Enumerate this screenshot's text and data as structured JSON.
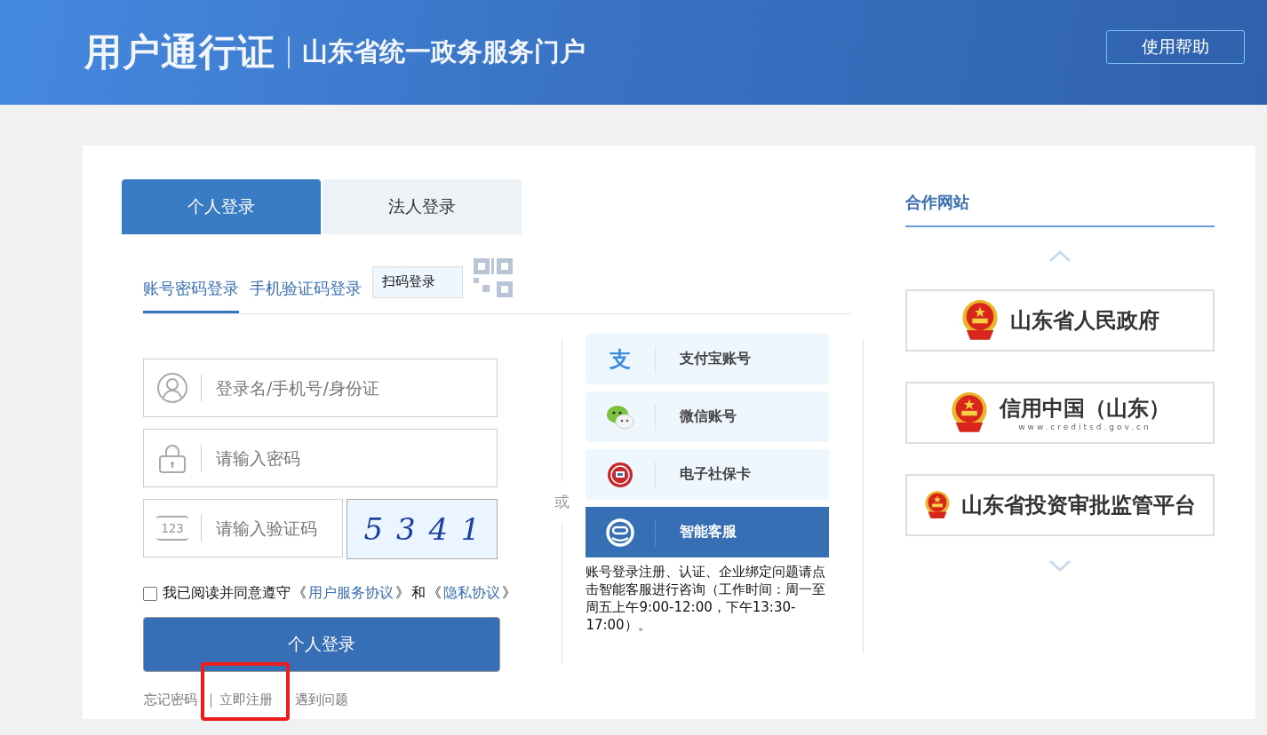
{
  "header": {
    "title": "用户通行证",
    "subtitle": "山东省统一政务服务门户",
    "help_button": "使用帮助"
  },
  "login_tabs": [
    {
      "label": "个人登录",
      "selected": true
    },
    {
      "label": "法人登录",
      "selected": false
    }
  ],
  "method_tabs": [
    {
      "label": "账号密码登录",
      "kind": "text",
      "selected": true
    },
    {
      "label": "手机验证码登录",
      "kind": "text",
      "selected": false
    },
    {
      "label": "扫码登录",
      "kind": "qr",
      "selected": false
    }
  ],
  "fields": [
    {
      "kind": "user",
      "placeholder": "登录名/手机号/身份证"
    },
    {
      "kind": "lock",
      "placeholder": "请输入密码"
    },
    {
      "kind": "code",
      "icon_text": "123",
      "placeholder": "请输入验证码",
      "captcha": "5 3 4 1"
    }
  ],
  "agreement": {
    "checked": false,
    "text": "我已阅读并同意遵守",
    "open1": "《",
    "link1": "用户服务协议",
    "close1": "》",
    "joiner": "和",
    "open2": "《",
    "link2": "隐私协议",
    "close2": "》"
  },
  "login_button": "个人登录",
  "footer_links": [
    {
      "label": "忘记密码",
      "marked": false
    },
    {
      "label": "立即注册",
      "marked": true
    },
    {
      "label": "遇到问题",
      "marked": false
    }
  ],
  "or_label": "或",
  "third_party": [
    {
      "kind": "alipay",
      "icon_glyph": "支",
      "label": "支付宝账号",
      "highlighted": false
    },
    {
      "kind": "wechat",
      "label": "微信账号",
      "highlighted": false
    },
    {
      "kind": "social_card",
      "label": "电子社保卡",
      "highlighted": false
    },
    {
      "kind": "robot",
      "label": "智能客服",
      "highlighted": true
    }
  ],
  "service_note": "账号登录注册、认证、企业绑定问题请点击智能客服进行咨询（工作时间：周一至周五上午9:00-12:00，下午13:30-17:00）。",
  "partners": {
    "title": "合作网站",
    "items": [
      {
        "name": "山东省人民政府"
      },
      {
        "name": "信用中国（山东）",
        "url": "www.creditsd.gov.cn"
      },
      {
        "name": "山东省投资审批监管平台"
      }
    ]
  }
}
